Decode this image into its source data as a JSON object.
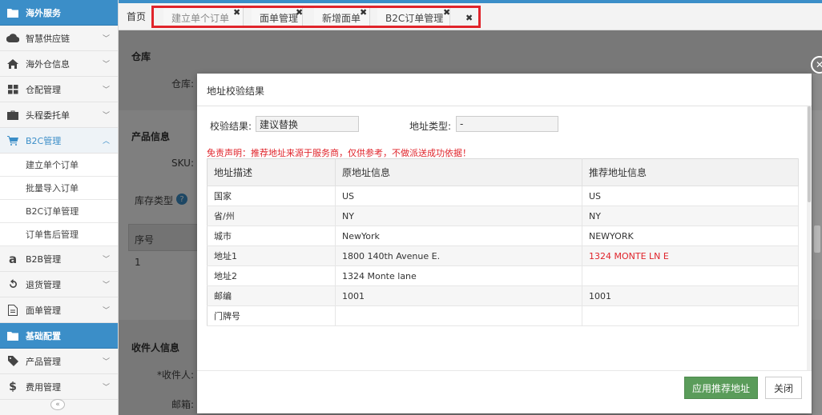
{
  "sidebar": {
    "items": [
      {
        "label": "海外服务",
        "icon": "folder-icon",
        "kind": "section"
      },
      {
        "label": "智慧供应链",
        "icon": "cloud-icon",
        "kind": "item"
      },
      {
        "label": "海外仓信息",
        "icon": "home-icon",
        "kind": "item"
      },
      {
        "label": "仓配管理",
        "icon": "grid-icon",
        "kind": "item"
      },
      {
        "label": "头程委托单",
        "icon": "briefcase-icon",
        "kind": "item"
      },
      {
        "label": "B2C管理",
        "icon": "cart-icon",
        "kind": "active"
      },
      {
        "label": "建立单个订单",
        "kind": "sub"
      },
      {
        "label": "批量导入订单",
        "kind": "sub"
      },
      {
        "label": "B2C订单管理",
        "kind": "sub"
      },
      {
        "label": "订单售后管理",
        "kind": "sub"
      },
      {
        "label": "B2B管理",
        "icon": "amazon-icon",
        "kind": "item"
      },
      {
        "label": "退货管理",
        "icon": "undo-icon",
        "kind": "item"
      },
      {
        "label": "面单管理",
        "icon": "document-icon",
        "kind": "item"
      },
      {
        "label": "基础配置",
        "icon": "folder-icon",
        "kind": "section"
      },
      {
        "label": "产品管理",
        "icon": "tag-icon",
        "kind": "item"
      },
      {
        "label": "费用管理",
        "icon": "dollar-icon",
        "kind": "item"
      }
    ],
    "collapse_glyph": "«"
  },
  "tabs": {
    "home": "首页",
    "items": [
      {
        "label": "建立单个订单",
        "close": "✖"
      },
      {
        "label": "面单管理",
        "close": "✖"
      },
      {
        "label": "新增面单",
        "close": "✖"
      },
      {
        "label": "B2C订单管理",
        "close": "✖"
      }
    ],
    "close_all": "✖"
  },
  "page": {
    "warehouse_section": "仓库",
    "warehouse_label": "仓库:",
    "product_section": "产品信息",
    "sku_label": "SKU:",
    "stock_type_label": "库存类型",
    "help_glyph": "?",
    "seq_header": "序号",
    "row1_seq": "1",
    "recipient_section": "收件人信息",
    "recipient_label": "*收件人:",
    "email_label": "邮箱:"
  },
  "modal": {
    "title": "地址校验结果",
    "result_label": "校验结果:",
    "result_value": "建议替换",
    "type_label": "地址类型:",
    "type_value": "-",
    "disclaimer": "免责声明：推荐地址来源于服务商，仅供参考，不做派送成功依据！",
    "columns": [
      "地址描述",
      "原地址信息",
      "推荐地址信息"
    ],
    "rows": [
      {
        "desc": "国家",
        "original": "US",
        "recommended": "US",
        "changed": false
      },
      {
        "desc": "省/州",
        "original": "NY",
        "recommended": "NY",
        "changed": false
      },
      {
        "desc": "城市",
        "original": "NewYork",
        "recommended": "NEWYORK",
        "changed": false
      },
      {
        "desc": "地址1",
        "original": "1800 140th Avenue E.",
        "recommended": "1324 MONTE LN E",
        "changed": true
      },
      {
        "desc": "地址2",
        "original": "1324 Monte lane",
        "recommended": "",
        "changed": false
      },
      {
        "desc": "邮编",
        "original": "1001",
        "recommended": "1001",
        "changed": false
      },
      {
        "desc": "门牌号",
        "original": "",
        "recommended": "",
        "changed": false
      }
    ],
    "apply_button": "应用推荐地址",
    "close_button": "关闭",
    "dismiss_glyph": "✕"
  },
  "colors": {
    "accent": "#3b8ec8",
    "highlight_border": "#e0242b",
    "apply_button": "#5a9c5a",
    "warning_text": "#e0242b"
  }
}
